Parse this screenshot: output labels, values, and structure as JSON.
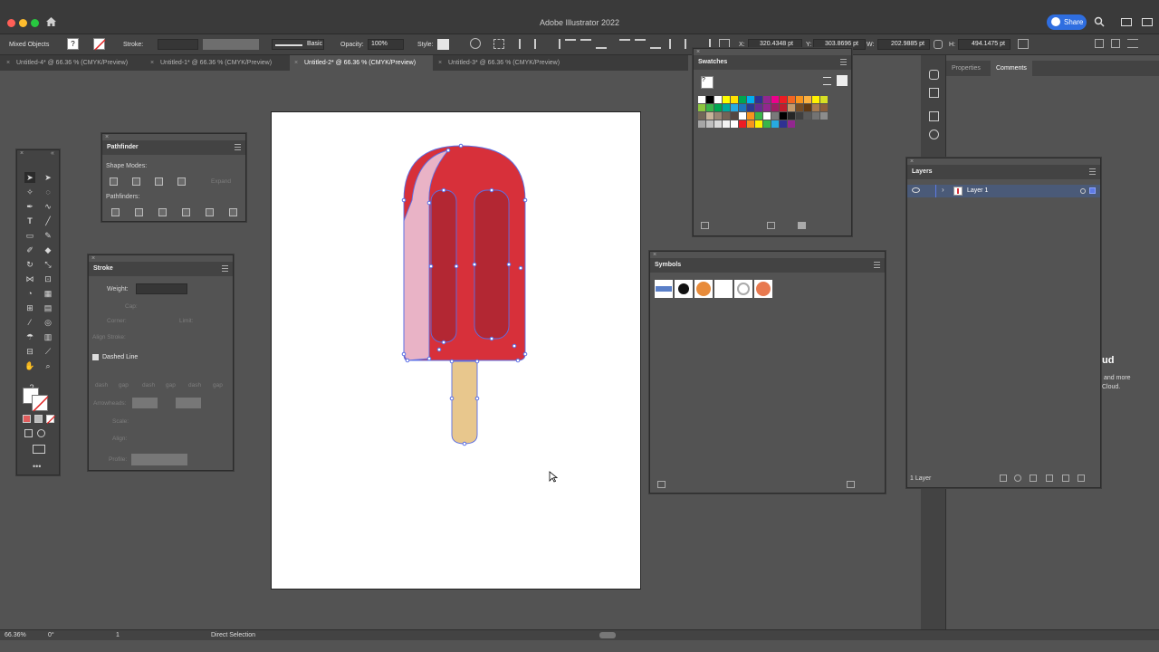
{
  "window": {
    "title": "Adobe Illustrator 2022",
    "share_label": "Share"
  },
  "controlbar": {
    "selection_type": "Mixed Objects",
    "stroke_label": "Stroke:",
    "brush_label": "Basic",
    "opacity_label": "Opacity:",
    "opacity_value": "100%",
    "style_label": "Style:",
    "x_label": "X:",
    "x_value": "320.4348 pt",
    "y_label": "Y:",
    "y_value": "303.8696 pt",
    "w_label": "W:",
    "w_value": "202.9885 pt",
    "h_label": "H:",
    "h_value": "494.1475 pt"
  },
  "tabs": [
    {
      "label": "Untitled-4* @ 66.36 % (CMYK/Preview)",
      "active": false
    },
    {
      "label": "Untitled-1* @ 66.36 % (CMYK/Preview)",
      "active": false
    },
    {
      "label": "Untitled-2* @ 66.36 % (CMYK/Preview)",
      "active": true
    },
    {
      "label": "Untitled-3* @ 66.36 % (CMYK/Preview)",
      "active": false
    }
  ],
  "pathfinder": {
    "title": "Pathfinder",
    "shape_modes_label": "Shape Modes:",
    "expand_label": "Expand",
    "pathfinders_label": "Pathfinders:"
  },
  "stroke_panel": {
    "title": "Stroke",
    "weight_label": "Weight:",
    "cap_label": "Cap:",
    "corner_label": "Corner:",
    "limit_label": "Limit:",
    "align_stroke_label": "Align Stroke:",
    "dashed_line_label": "Dashed Line",
    "dash_labels": [
      "dash",
      "gap",
      "dash",
      "gap",
      "dash",
      "gap"
    ],
    "arrowheads_label": "Arrowheads:",
    "scale_label": "Scale:",
    "align_label": "Align:",
    "profile_label": "Profile:"
  },
  "swatches": {
    "title": "Swatches",
    "colors": [
      "#ffffff",
      "#000000",
      "#ffffff",
      "#ffff00",
      "#ffe000",
      "#00a651",
      "#00aeef",
      "#2e3192",
      "#92278f",
      "#ec008c",
      "#ed1c24",
      "#f26522",
      "#f7941d",
      "#fbb040",
      "#fff200",
      "#d7df23",
      "#8dc63f",
      "#39b54a",
      "#00a651",
      "#00a99d",
      "#27aae1",
      "#1c75bc",
      "#2b3990",
      "#662d91",
      "#92278f",
      "#9e1f63",
      "#be1e2d",
      "#c49a6c",
      "#754c24",
      "#603913",
      "#a97c50",
      "#8b5e3c",
      "#726658",
      "#c7b299",
      "#998675",
      "#736357",
      "#534741",
      "#ffffff",
      "#f7941d",
      "#39b54a",
      "#ffffff",
      "#7a7a7a",
      "#000000",
      "#262626",
      "#404040",
      "#595959",
      "#737373",
      "#8c8c8c",
      "#a6a6a6",
      "#bfbfbf",
      "#d9d9d9",
      "#f2f2f2",
      "#ffffff",
      "#ed1c24",
      "#f7941d",
      "#fff200",
      "#39b54a",
      "#27aae1",
      "#2e3192",
      "#92278f"
    ]
  },
  "symbols": {
    "title": "Symbols"
  },
  "layers": {
    "title": "Layers",
    "layer_name": "Layer 1",
    "count_label": "1 Layer"
  },
  "rightdock": {
    "properties_tab": "Properties",
    "comments_tab": "Comments",
    "cloud_heading": "ud",
    "cloud_text_1": "and more",
    "cloud_text_2": "Cloud."
  },
  "statusbar": {
    "zoom": "66.36%",
    "rotation": "0°",
    "artboard_number": "1",
    "tool_name": "Direct Selection"
  },
  "colors": {
    "popsicle_red": "#d7303a",
    "popsicle_dark": "#b32733",
    "popsicle_highlight": "#e9b3c6",
    "stick": "#e8c78d",
    "selection_blue": "#5b6fe6",
    "share_blue": "#2f6ee0"
  }
}
